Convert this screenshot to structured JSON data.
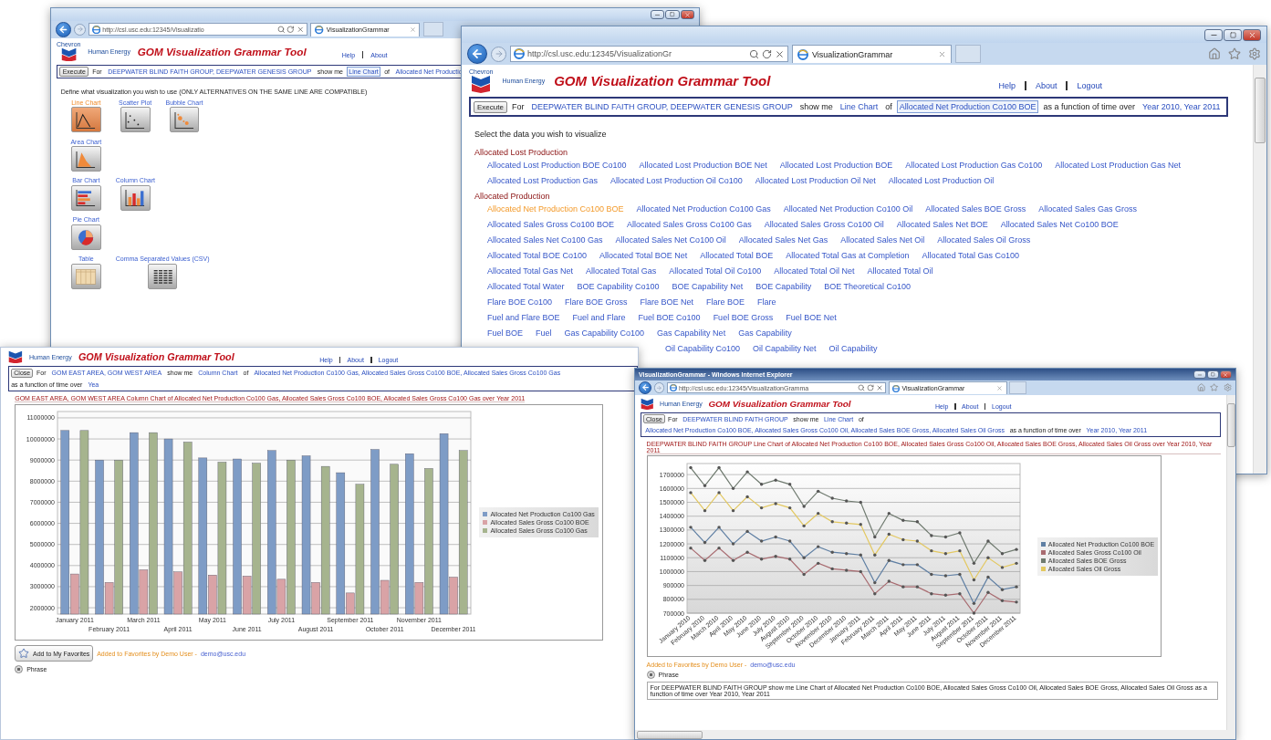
{
  "windows": [
    {
      "kind": "chart_picker",
      "address": "http://csl.usc.edu:12345/Visualizatio",
      "tab": "VisualizationGrammar",
      "header": {
        "logo_word": "Chevron",
        "tagline": "Human Energy",
        "title": "GOM Visualization Grammar Tool",
        "links": [
          "Help",
          "About"
        ]
      },
      "query": {
        "button": "Execute",
        "parts": [
          {
            "kind": "text",
            "text": "For"
          },
          {
            "kind": "link",
            "text": "DEEPWATER BLIND FAITH GROUP, DEEPWATER GENESIS GROUP",
            "selected": false
          },
          {
            "kind": "text",
            "text": "show me"
          },
          {
            "kind": "link",
            "text": "Line Chart",
            "selected": true
          },
          {
            "kind": "text",
            "text": "of"
          },
          {
            "kind": "link",
            "text": "Allocated Net Productio",
            "selected": false
          }
        ]
      },
      "prompt": "Define what visualization you wish to use (ONLY ALTERNATIVES ON THE SAME LINE ARE COMPATIBLE)",
      "chart_types": [
        [
          {
            "kind": "line",
            "label": "Line Chart",
            "selected": true
          },
          {
            "kind": "scatter",
            "label": "Scatter Plot",
            "selected": false
          },
          {
            "kind": "bubble",
            "label": "Bubble Chart",
            "selected": false
          }
        ],
        [
          {
            "kind": "area",
            "label": "Area Chart",
            "selected": false
          }
        ],
        [
          {
            "kind": "bar",
            "label": "Bar Chart",
            "selected": false
          },
          {
            "kind": "column",
            "label": "Column Chart",
            "selected": false
          }
        ],
        [
          {
            "kind": "pie",
            "label": "Pie Chart",
            "selected": false
          }
        ],
        [
          {
            "kind": "table",
            "label": "Table",
            "selected": false
          },
          {
            "kind": "csv",
            "label": "Comma Separated Values (CSV)",
            "selected": false
          }
        ]
      ]
    },
    {
      "kind": "data_picker",
      "address": "http://csl.usc.edu:12345/VisualizationGr",
      "tab": "VisualizationGrammar",
      "header": {
        "logo_word": "Chevron",
        "tagline": "Human Energy",
        "title": "GOM Visualization Grammar Tool",
        "links": [
          "Help",
          "About",
          "Logout"
        ]
      },
      "query": {
        "button": "Execute",
        "parts": [
          {
            "kind": "text",
            "text": "For"
          },
          {
            "kind": "link",
            "text": "DEEPWATER BLIND FAITH GROUP, DEEPWATER GENESIS GROUP",
            "selected": false
          },
          {
            "kind": "text",
            "text": "show me"
          },
          {
            "kind": "link",
            "text": "Line Chart",
            "selected": false
          },
          {
            "kind": "text",
            "text": "of"
          },
          {
            "kind": "link",
            "text": "Allocated Net Production Co100 BOE",
            "selected": true
          },
          {
            "kind": "text",
            "text": "as a function of time over"
          },
          {
            "kind": "link",
            "text": "Year 2010, Year 2011",
            "selected": false
          }
        ]
      },
      "prompt": "Select the data you wish to visualize",
      "groups": [
        {
          "title": "Allocated Lost Production",
          "rows": [
            {
              "partial": false,
              "items": [
                {
                  "label": "Allocated Lost Production BOE Co100",
                  "selected": false
                },
                {
                  "label": "Allocated Lost Production BOE Net",
                  "selected": false
                },
                {
                  "label": "Allocated Lost Production BOE",
                  "selected": false
                },
                {
                  "label": "Allocated Lost Production Gas Co100",
                  "selected": false
                },
                {
                  "label": "Allocated Lost Production Gas Net",
                  "selected": false
                }
              ]
            },
            {
              "partial": false,
              "items": [
                {
                  "label": "Allocated Lost Production Gas",
                  "selected": false
                },
                {
                  "label": "Allocated Lost Production Oil Co100",
                  "selected": false
                },
                {
                  "label": "Allocated Lost Production Oil Net",
                  "selected": false
                },
                {
                  "label": "Allocated Lost Production Oil",
                  "selected": false
                }
              ]
            }
          ]
        },
        {
          "title": "Allocated Production",
          "rows": [
            {
              "partial": false,
              "items": [
                {
                  "label": "Allocated Net Production Co100 BOE",
                  "selected": true
                },
                {
                  "label": "Allocated Net Production Co100 Gas",
                  "selected": false
                },
                {
                  "label": "Allocated Net Production Co100 Oil",
                  "selected": false
                },
                {
                  "label": "Allocated Sales BOE Gross",
                  "selected": false
                },
                {
                  "label": "Allocated Sales Gas Gross",
                  "selected": false
                }
              ]
            },
            {
              "partial": false,
              "items": [
                {
                  "label": "Allocated Sales Gross Co100 BOE",
                  "selected": false
                },
                {
                  "label": "Allocated Sales Gross Co100 Gas",
                  "selected": false
                },
                {
                  "label": "Allocated Sales Gross Co100 Oil",
                  "selected": false
                },
                {
                  "label": "Allocated Sales Net BOE",
                  "selected": false
                },
                {
                  "label": "Allocated Sales Net Co100 BOE",
                  "selected": false
                }
              ]
            },
            {
              "partial": false,
              "items": [
                {
                  "label": "Allocated Sales Net Co100 Gas",
                  "selected": false
                },
                {
                  "label": "Allocated Sales Net Co100 Oil",
                  "selected": false
                },
                {
                  "label": "Allocated Sales Net Gas",
                  "selected": false
                },
                {
                  "label": "Allocated Sales Net Oil",
                  "selected": false
                },
                {
                  "label": "Allocated Sales Oil Gross",
                  "selected": false
                }
              ]
            },
            {
              "partial": false,
              "items": [
                {
                  "label": "Allocated Total BOE Co100",
                  "selected": false
                },
                {
                  "label": "Allocated Total BOE Net",
                  "selected": false
                },
                {
                  "label": "Allocated Total BOE",
                  "selected": false
                },
                {
                  "label": "Allocated Total Gas at Completion",
                  "selected": false
                },
                {
                  "label": "Allocated Total Gas Co100",
                  "selected": false
                }
              ]
            },
            {
              "partial": false,
              "items": [
                {
                  "label": "Allocated Total Gas Net",
                  "selected": false
                },
                {
                  "label": "Allocated Total Gas",
                  "selected": false
                },
                {
                  "label": "Allocated Total Oil Co100",
                  "selected": false
                },
                {
                  "label": "Allocated Total Oil Net",
                  "selected": false
                },
                {
                  "label": "Allocated Total Oil",
                  "selected": false
                }
              ]
            },
            {
              "partial": false,
              "items": [
                {
                  "label": "Allocated Total Water",
                  "selected": false
                },
                {
                  "label": "BOE Capability Co100",
                  "selected": false
                },
                {
                  "label": "BOE Capability Net",
                  "selected": false
                },
                {
                  "label": "BOE Capability",
                  "selected": false
                },
                {
                  "label": "BOE Theoretical Co100",
                  "selected": false
                }
              ]
            },
            {
              "partial": false,
              "items": [
                {
                  "label": "Flare BOE Co100",
                  "selected": false
                },
                {
                  "label": "Flare BOE Gross",
                  "selected": false
                },
                {
                  "label": "Flare BOE Net",
                  "selected": false
                },
                {
                  "label": "Flare BOE",
                  "selected": false
                },
                {
                  "label": "Flare",
                  "selected": false
                }
              ]
            },
            {
              "partial": false,
              "items": [
                {
                  "label": "Fuel and Flare BOE",
                  "selected": false
                },
                {
                  "label": "Fuel and Flare",
                  "selected": false
                },
                {
                  "label": "Fuel BOE Co100",
                  "selected": false
                },
                {
                  "label": "Fuel BOE Gross",
                  "selected": false
                },
                {
                  "label": "Fuel BOE Net",
                  "selected": false
                }
              ]
            },
            {
              "partial": false,
              "items": [
                {
                  "label": "Fuel BOE",
                  "selected": false
                },
                {
                  "label": "Fuel",
                  "selected": false
                },
                {
                  "label": "Gas Capability Co100",
                  "selected": false
                },
                {
                  "label": "Gas Capability Net",
                  "selected": false
                },
                {
                  "label": "Gas Capability",
                  "selected": false
                }
              ]
            },
            {
              "partial": true,
              "items": [
                {
                  "label": "Oil Capability Co100",
                  "selected": false
                },
                {
                  "label": "Oil Capability Net",
                  "selected": false
                },
                {
                  "label": "Oil Capability",
                  "selected": false
                }
              ]
            }
          ]
        }
      ]
    },
    {
      "kind": "column_result",
      "header": {
        "tagline": "Human Energy",
        "title": "GOM Visualization Grammar Tool",
        "links": [
          "Help",
          "About",
          "Logout"
        ]
      },
      "query": {
        "button": "Close",
        "parts": [
          {
            "kind": "text",
            "text": "For"
          },
          {
            "kind": "link",
            "text": "GOM EAST AREA, GOM WEST AREA",
            "selected": false
          },
          {
            "kind": "text",
            "text": "show me"
          },
          {
            "kind": "link",
            "text": "Column Chart",
            "selected": false
          },
          {
            "kind": "text",
            "text": "of"
          },
          {
            "kind": "link",
            "text": "Allocated Net Production Co100 Gas, Allocated Sales Gross Co100 BOE, Allocated Sales Gross Co100 Gas",
            "selected": false
          },
          {
            "kind": "text",
            "text": "as a function of time over"
          },
          {
            "kind": "link",
            "text": "Yea",
            "selected": false
          }
        ]
      },
      "description": "GOM EAST AREA, GOM WEST AREA Column Chart of Allocated Net Production Co100 Gas, Allocated Sales Gross Co100 BOE, Allocated Sales Gross Co100 Gas over Year 2011",
      "chart_data": {
        "type": "bar",
        "grid": true,
        "categories": [
          "January 2011",
          "February 2011",
          "March 2011",
          "April 2011",
          "May 2011",
          "June 2011",
          "July 2011",
          "August 2011",
          "September 2011",
          "October 2011",
          "November 2011",
          "December 2011"
        ],
        "ylim": [
          1700000,
          11300000
        ],
        "yticks": [
          2000000,
          3000000,
          4000000,
          5000000,
          6000000,
          7000000,
          8000000,
          9000000,
          10000000,
          11000000
        ],
        "series": [
          {
            "name": "Allocated Net Production Co100 Gas",
            "color": "#7e9cc6",
            "values": [
              10400000,
              9000000,
              10300000,
              10000000,
              9100000,
              9050000,
              9450000,
              9200000,
              8400000,
              9500000,
              9300000,
              10250000
            ]
          },
          {
            "name": "Allocated Sales Gross Co100 BOE",
            "color": "#d9a3a6",
            "values": [
              3600000,
              3200000,
              3800000,
              3700000,
              3550000,
              3500000,
              3350000,
              3200000,
              2700000,
              3300000,
              3200000,
              3450000
            ]
          },
          {
            "name": "Allocated Sales Gross Co100 Gas",
            "color": "#a6b48e",
            "values": [
              10400000,
              9000000,
              10300000,
              9850000,
              8900000,
              8850000,
              9000000,
              8700000,
              7850000,
              8800000,
              8600000,
              9450000
            ]
          }
        ]
      },
      "favorite_button": "Add to My Favorites",
      "favorite_note": "Added to Favorites by Demo User -",
      "favorite_user": "demo@usc.edu",
      "phrase_label": "Phrase",
      "phrase_selected": true
    },
    {
      "kind": "line_result",
      "window_title": "VisualizationGrammar - Windows Internet Explorer",
      "address": "http://csl.usc.edu:12345/VisualizationGramma",
      "tab": "VisualizationGrammar",
      "header": {
        "tagline": "Human Energy",
        "title": "GOM Visualization Grammar Tool",
        "links": [
          "Help",
          "About",
          "Logout"
        ]
      },
      "query": {
        "button": "Close",
        "parts": [
          {
            "kind": "text",
            "text": "For"
          },
          {
            "kind": "link",
            "text": "DEEPWATER BLIND FAITH GROUP",
            "selected": false
          },
          {
            "kind": "text",
            "text": "show me"
          },
          {
            "kind": "link",
            "text": "Line Chart",
            "selected": false
          },
          {
            "kind": "text",
            "text": "of"
          },
          {
            "kind": "link",
            "text": "Allocated Net Production Co100 BOE, Allocated Sales Gross Co100 Oil, Allocated Sales BOE Gross, Allocated Sales Oil Gross",
            "selected": false
          },
          {
            "kind": "text",
            "text": "as a function of time over"
          },
          {
            "kind": "link",
            "text": "Year 2010, Year 2011",
            "selected": false
          }
        ]
      },
      "description": "DEEPWATER BLIND FAITH GROUP Line Chart of Allocated Net Production Co100 BOE, Allocated Sales Gross Co100 Oil, Allocated Sales BOE Gross, Allocated Sales Oil Gross over Year 2010, Year 2011",
      "chart_data": {
        "type": "line",
        "grid": true,
        "categories": [
          "January 2010",
          "February 2010",
          "March 2010",
          "April 2010",
          "May 2010",
          "June 2010",
          "July 2010",
          "August 2010",
          "September 2010",
          "October 2010",
          "November 2010",
          "December 2010",
          "January 2011",
          "February 2011",
          "March 2011",
          "April 2011",
          "May 2011",
          "June 2011",
          "July 2011",
          "August 2011",
          "September 2011",
          "October 2011",
          "November 2011",
          "December 2011"
        ],
        "ylim": [
          700000,
          1780000
        ],
        "yticks": [
          700000,
          800000,
          900000,
          1000000,
          1100000,
          1200000,
          1300000,
          1400000,
          1500000,
          1600000,
          1700000
        ],
        "series": [
          {
            "name": "Allocated Net Production Co100 BOE",
            "color": "#5f7fa3",
            "values": [
              1320000,
              1210000,
              1320000,
              1200000,
              1290000,
              1220000,
              1250000,
              1220000,
              1100000,
              1180000,
              1140000,
              1130000,
              1120000,
              920000,
              1080000,
              1050000,
              1050000,
              980000,
              970000,
              980000,
              770000,
              960000,
              870000,
              890000
            ]
          },
          {
            "name": "Allocated Sales Gross Co100 Oil",
            "color": "#a86b70",
            "values": [
              1170000,
              1080000,
              1170000,
              1080000,
              1140000,
              1090000,
              1110000,
              1090000,
              980000,
              1060000,
              1020000,
              1010000,
              1000000,
              840000,
              930000,
              890000,
              890000,
              840000,
              830000,
              840000,
              700000,
              850000,
              790000,
              780000
            ]
          },
          {
            "name": "Allocated Sales BOE Gross",
            "color": "#6f7a6f",
            "values": [
              1750000,
              1620000,
              1750000,
              1600000,
              1720000,
              1630000,
              1660000,
              1630000,
              1470000,
              1580000,
              1530000,
              1510000,
              1500000,
              1250000,
              1420000,
              1370000,
              1360000,
              1260000,
              1250000,
              1280000,
              1060000,
              1220000,
              1130000,
              1160000
            ]
          },
          {
            "name": "Allocated Sales Oil Gross",
            "color": "#e3c860",
            "values": [
              1570000,
              1440000,
              1570000,
              1440000,
              1540000,
              1460000,
              1490000,
              1460000,
              1330000,
              1420000,
              1360000,
              1350000,
              1340000,
              1120000,
              1270000,
              1230000,
              1220000,
              1150000,
              1130000,
              1150000,
              940000,
              1100000,
              1030000,
              1060000
            ]
          }
        ]
      },
      "favorite_note": "Added to Favorites by Demo User -",
      "favorite_user": "demo@usc.edu",
      "phrase_label": "Phrase",
      "phrase_selected": true,
      "phrase_text": "For DEEPWATER BLIND FAITH GROUP show me Line Chart of Allocated Net Production Co100 BOE, Allocated Sales Gross Co100 Oil, Allocated Sales BOE Gross, Allocated Sales Oil Gross as a function of time over Year 2010, Year 2011"
    }
  ]
}
